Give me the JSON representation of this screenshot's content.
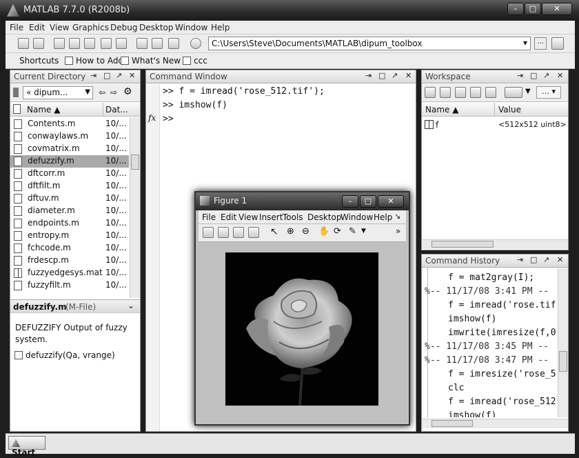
{
  "window": {
    "title": "MATLAB  7.7.0 (R2008b)"
  },
  "menubar": [
    "File",
    "Edit",
    "View",
    "Graphics",
    "Debug",
    "Desktop",
    "Window",
    "Help"
  ],
  "toolbar": {
    "current_folder": "C:\\Users\\Steve\\Documents\\MATLAB\\dipum_toolbox",
    "browse_label": "...",
    "dropdown_label": "▾"
  },
  "shortcuts": {
    "label": "Shortcuts",
    "items": [
      "How to Add",
      "What's New",
      "ccc"
    ]
  },
  "current_directory": {
    "title": "Current Directory",
    "path_label": "«  dipum...",
    "col_name": "Name ▲",
    "col_date": "Dat...",
    "files": [
      {
        "name": "Contents.m",
        "date": "10/..."
      },
      {
        "name": "conwaylaws.m",
        "date": "10/..."
      },
      {
        "name": "covmatrix.m",
        "date": "10/..."
      },
      {
        "name": "defuzzify.m",
        "date": "10/...",
        "selected": true
      },
      {
        "name": "dftcorr.m",
        "date": "10/..."
      },
      {
        "name": "dftfilt.m",
        "date": "10/..."
      },
      {
        "name": "dftuv.m",
        "date": "10/..."
      },
      {
        "name": "diameter.m",
        "date": "10/..."
      },
      {
        "name": "endpoints.m",
        "date": "10/..."
      },
      {
        "name": "entropy.m",
        "date": "10/..."
      },
      {
        "name": "fchcode.m",
        "date": "10/..."
      },
      {
        "name": "frdescp.m",
        "date": "10/..."
      },
      {
        "name": "fuzzyedgesys.mat",
        "date": "10/..."
      },
      {
        "name": "fuzzyfilt.m",
        "date": "10/..."
      }
    ],
    "detail": {
      "name": "defuzzify.m",
      "type": "(M-File)",
      "description": "DEFUZZIFY Output of fuzzy system.",
      "signature": "defuzzify(Qa, vrange)"
    }
  },
  "command_window": {
    "title": "Command Window",
    "lines": [
      ">> f = imread('rose_512.tif');",
      ">> imshow(f)",
      ">>"
    ],
    "fx": "fx"
  },
  "workspace": {
    "title": "Workspace",
    "col_name": "Name ▲",
    "col_value": "Value",
    "variables": [
      {
        "name": "f",
        "value": "<512x512 uint8>"
      }
    ]
  },
  "command_history": {
    "title": "Command History",
    "lines": [
      {
        "text": "f = mat2gray(I);",
        "kind": "cmd"
      },
      {
        "text": "%-- 11/17/08  3:41 PM --",
        "kind": "session"
      },
      {
        "text": "f = imread('rose.tif",
        "kind": "cmd"
      },
      {
        "text": "imshow(f)",
        "kind": "cmd"
      },
      {
        "text": "imwrite(imresize(f,0",
        "kind": "cmd"
      },
      {
        "text": "%-- 11/17/08  3:45 PM --",
        "kind": "session"
      },
      {
        "text": "%-- 11/17/08  3:47 PM --",
        "kind": "session"
      },
      {
        "text": "f = imresize('rose_5",
        "kind": "cmd"
      },
      {
        "text": "clc",
        "kind": "cmd"
      },
      {
        "text": "f = imread('rose_512",
        "kind": "cmd"
      },
      {
        "text": "imshow(f)",
        "kind": "cmd"
      }
    ]
  },
  "figure": {
    "title": "Figure 1",
    "menu": [
      "File",
      "Edit",
      "View",
      "Insert",
      "Tools",
      "Desktop",
      "Window",
      "Help"
    ]
  },
  "statusbar": {
    "start_label": "Start"
  }
}
